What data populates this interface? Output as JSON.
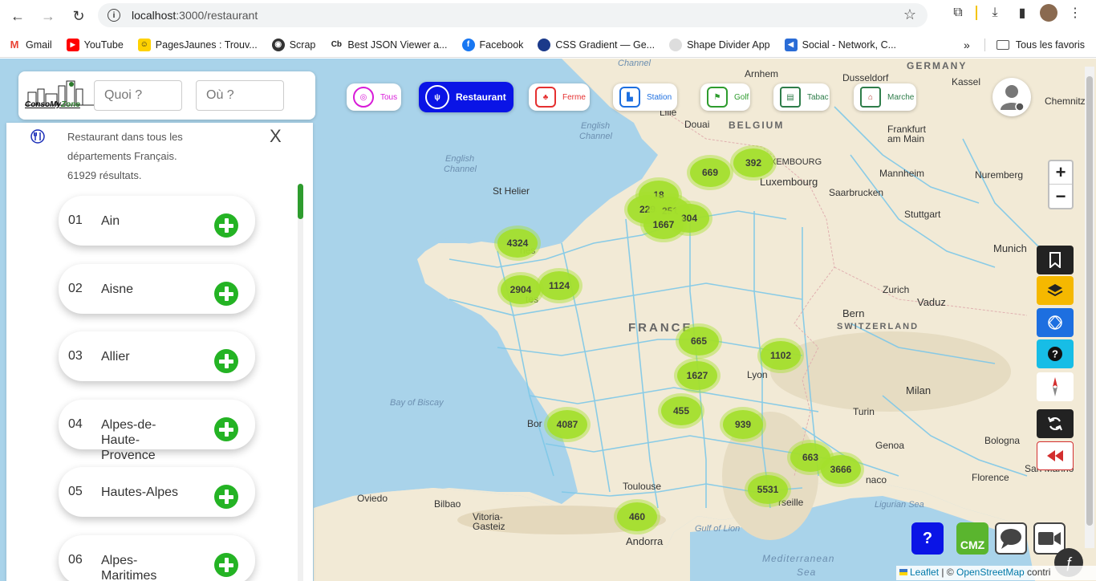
{
  "browser": {
    "url_host": "localhost",
    "url_path": ":3000/restaurant",
    "bookmarks": [
      {
        "label": "Gmail",
        "icon": "gmail-icon",
        "color": "#ea4335",
        "glyph": "M"
      },
      {
        "label": "YouTube",
        "icon": "youtube-icon",
        "color": "#ff0000",
        "glyph": "▶"
      },
      {
        "label": "PagesJaunes : Trouv...",
        "icon": "pagesjaunes-icon",
        "color": "#ffd200",
        "glyph": "☺"
      },
      {
        "label": "Scrap",
        "icon": "globe-icon",
        "color": "#333333",
        "glyph": "◉"
      },
      {
        "label": "Best JSON Viewer a...",
        "icon": "cb-icon",
        "color": "#ffffff",
        "glyph": "Cb"
      },
      {
        "label": "Facebook",
        "icon": "facebook-icon",
        "color": "#1877f2",
        "glyph": "f"
      },
      {
        "label": "CSS Gradient — Ge...",
        "icon": "cssgradient-icon",
        "color": "#1b3a8a",
        "glyph": "●"
      },
      {
        "label": "Shape Divider App",
        "icon": "shapedivider-icon",
        "color": "#dddddd",
        "glyph": "◐"
      },
      {
        "label": "Social - Network, C...",
        "icon": "social-icon",
        "color": "#2a6cd6",
        "glyph": "◀"
      }
    ],
    "all_favorites": "Tous les favoris"
  },
  "header": {
    "logo_brand": "ConsoMy",
    "logo_zone": "Zone",
    "what_placeholder": "Quoi ?",
    "where_placeholder": "Où ?"
  },
  "results": {
    "description_line1": "Restaurant dans tous les",
    "description_line2": "départements Français.",
    "count_text": "61929 résultats.",
    "close": "X"
  },
  "departments": [
    {
      "num": "01",
      "name": "Ain"
    },
    {
      "num": "02",
      "name": "Aisne"
    },
    {
      "num": "03",
      "name": "Allier"
    },
    {
      "num": "04",
      "name": "Alpes-de-Haute-Provence"
    },
    {
      "num": "05",
      "name": "Hautes-Alpes"
    },
    {
      "num": "06",
      "name": "Alpes-Maritimes"
    }
  ],
  "categories": [
    {
      "label": "Tous",
      "color": "#d81bd8",
      "glyph": "◎"
    },
    {
      "label": "Restaurant",
      "color": "#ffffff",
      "glyph": "🍴"
    },
    {
      "label": "Ferme",
      "color": "#e53030",
      "glyph": "♣"
    },
    {
      "label": "Station",
      "color": "#1d6fe0",
      "glyph": "⛽"
    },
    {
      "label": "Golf",
      "color": "#2e9c2e",
      "glyph": "⛳"
    },
    {
      "label": "Tabac",
      "color": "#2e7d4a",
      "glyph": "▤"
    },
    {
      "label": "Marche",
      "color": "#2e7d4a",
      "glyph": "⌂"
    }
  ],
  "clusters": [
    "669",
    "392",
    "18",
    "229",
    "251",
    "304",
    "1667",
    "4324",
    "2904",
    "1124",
    "665",
    "1102",
    "1627",
    "455",
    "939",
    "4087",
    "663",
    "3666",
    "5531",
    "460"
  ],
  "map_labels": {
    "germany": "GERMANY",
    "belgium": "BELGIUM",
    "france": "FRANCE",
    "switzerland": "SWITZERLAND",
    "luxembourg": "Luxembourg",
    "english_channel_1": "English",
    "english_channel_2": "Channel",
    "english_channel_3": "English",
    "english_channel_4": "Channel",
    "channel_top": "Channel",
    "bay_of_biscay": "Bay of Biscay",
    "gulf_of_lion": "Gulf of Lion",
    "ligurian_sea": "Ligurian Sea",
    "mediterranean_1": "Mediterranean",
    "mediterranean_2": "Sea",
    "arnhem": "Arnhem",
    "dusseldorf": "Dusseldorf",
    "kassel": "Kassel",
    "chemnitz": "Chemnitz",
    "frankfurt_1": "Frankfurt",
    "frankfurt_2": "am Main",
    "mannheim": "Mannheim",
    "nuremberg": "Nuremberg",
    "saarbrucken": "Saarbrucken",
    "stuttgart": "Stuttgart",
    "munich": "Munich",
    "zurich": "Zurich",
    "vaduz": "Vaduz",
    "bern": "Bern",
    "milan": "Milan",
    "turin": "Turin",
    "genoa": "Genoa",
    "bologna": "Bologna",
    "san_marino": "San Marino",
    "florence": "Florence",
    "monaco": "naco",
    "marseille": "rseille",
    "toulouse": "Toulouse",
    "andorra": "Andorra",
    "oviedo": "Oviedo",
    "bilbao": "Bilbao",
    "vitoria_1": "Vitoria-",
    "vitoria_2": "Gasteiz",
    "st_helier": "St Helier",
    "lille": "Lille",
    "douai": "Douai",
    "lyon": "Lyon",
    "bordeaux": "Bor",
    "rennes": "nes",
    "nantes": "tes"
  },
  "zoom": {
    "in": "+",
    "out": "−"
  },
  "bottom": {
    "help": "?",
    "cmz": "CMZ"
  },
  "attribution": {
    "leaflet": "Leaflet",
    "sep": " | © ",
    "osm": "OpenStreetMap",
    "rest": " contri"
  },
  "colors": {
    "accent_blue": "#0a14e6",
    "cluster_green": "#a4e02c",
    "add_green": "#24b324"
  }
}
